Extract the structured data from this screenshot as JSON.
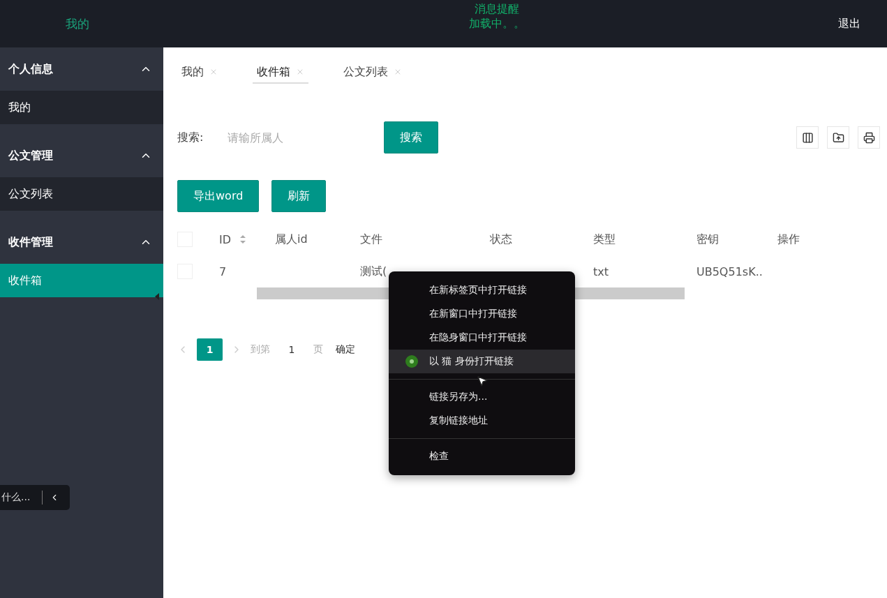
{
  "top_bar": {
    "title": "我的",
    "notice_title": "消息提醒",
    "notice_status": "加载中。。",
    "logout": "退出"
  },
  "sidebar": {
    "groups": [
      {
        "label": "个人信息",
        "expanded": true,
        "items": [
          {
            "label": "我的",
            "selected": false
          }
        ]
      },
      {
        "label": "公文管理",
        "expanded": true,
        "items": [
          {
            "label": "公文列表",
            "selected": false
          }
        ]
      },
      {
        "label": "收件管理",
        "expanded": true,
        "items": [
          {
            "label": "收件箱",
            "selected": true
          }
        ]
      }
    ]
  },
  "assistant": {
    "text": "什么..."
  },
  "tabs": [
    {
      "label": "我的",
      "selected": false
    },
    {
      "label": "收件箱",
      "selected": true
    },
    {
      "label": "公文列表",
      "selected": false
    }
  ],
  "search": {
    "label": "搜索:",
    "placeholder": "请输所属人",
    "button": "搜索"
  },
  "actions": [
    "导出word",
    "刷新"
  ],
  "table": {
    "header_checked": false,
    "columns": [
      {
        "label": "ID",
        "sortable": true
      },
      {
        "label": "属人id",
        "sortable": false
      },
      {
        "label": "文件",
        "sortable": false
      },
      {
        "label": "状态",
        "sortable": false
      },
      {
        "label": "类型",
        "sortable": false
      },
      {
        "label": "密钥",
        "sortable": false
      },
      {
        "label": "操作",
        "sortable": false
      }
    ],
    "rows": [
      {
        "checked": false,
        "cells": [
          "7",
          null,
          "测试(",
          null,
          "txt",
          "UB5Q51sK..",
          null
        ]
      }
    ]
  },
  "pagination": {
    "pages": [
      {
        "label": "1",
        "selected": true
      }
    ],
    "goto_label": "到第",
    "goto_value": "1",
    "page_unit": "页",
    "confirm": "确定"
  },
  "context_menu": {
    "groups": [
      [
        {
          "label": "在新标签页中打开链接",
          "kind": "plain",
          "highlighted": false
        },
        {
          "label": "在新窗口中打开链接",
          "kind": "plain",
          "highlighted": false
        },
        {
          "label": "在隐身窗口中打开链接",
          "kind": "plain",
          "highlighted": false
        },
        {
          "label": "以 猫 身份打开链接",
          "kind": "profile",
          "highlighted": true
        }
      ],
      [
        {
          "label": "链接另存为...",
          "kind": "plain",
          "highlighted": false
        },
        {
          "label": "复制链接地址",
          "kind": "plain",
          "highlighted": false
        }
      ],
      [
        {
          "label": "检查",
          "kind": "plain",
          "highlighted": false
        }
      ]
    ]
  }
}
